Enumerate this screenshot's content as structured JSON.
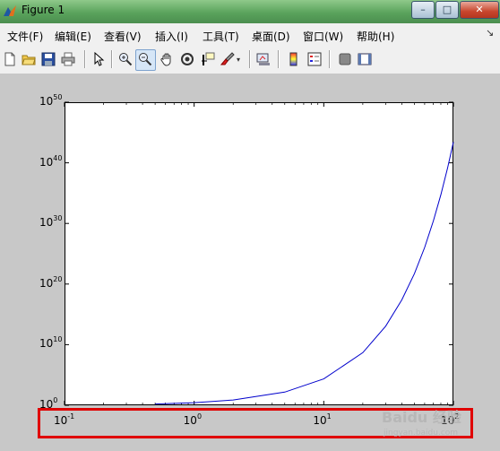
{
  "window": {
    "title": "Figure 1",
    "buttons": {
      "minimize": "–",
      "maximize": "□",
      "close": "✕"
    }
  },
  "menu": {
    "items": [
      "文件(F)",
      "编辑(E)",
      "查看(V)",
      "插入(I)",
      "工具(T)",
      "桌面(D)",
      "窗口(W)",
      "帮助(H)"
    ],
    "overflow": "↘"
  },
  "toolbar": {
    "icons": [
      "new-figure-icon",
      "open-file-icon",
      "save-icon",
      "print-icon",
      "pointer-icon",
      "zoom-in-icon",
      "zoom-out-icon",
      "pan-icon",
      "rotate-icon",
      "data-cursor-icon",
      "brush-icon",
      "link-plot-icon",
      "colorbar-icon",
      "legend-icon",
      "hide-plot-tools-icon",
      "show-plot-tools-icon"
    ],
    "active": "zoom-out-icon"
  },
  "chart_data": {
    "type": "line",
    "xscale": "log",
    "yscale": "log",
    "xlim": [
      0.1,
      100
    ],
    "ylim": [
      1,
      1e+50
    ],
    "x_ticks": [
      {
        "base": "10",
        "exp": "-1"
      },
      {
        "base": "10",
        "exp": "0"
      },
      {
        "base": "10",
        "exp": "1"
      },
      {
        "base": "10",
        "exp": "2"
      }
    ],
    "y_ticks": [
      {
        "base": "10",
        "exp": "50"
      },
      {
        "base": "10",
        "exp": "40"
      },
      {
        "base": "10",
        "exp": "30"
      },
      {
        "base": "10",
        "exp": "20"
      },
      {
        "base": "10",
        "exp": "10"
      },
      {
        "base": "10",
        "exp": "0"
      }
    ],
    "series": [
      {
        "color": "#0000cc",
        "x": [
          0.5,
          1,
          2,
          5,
          10,
          20,
          30,
          40,
          50,
          60,
          70,
          80,
          90,
          100
        ],
        "y": [
          1.6,
          2.7,
          7.4,
          148,
          22000.0,
          490000000.0,
          11000000000000.0,
          2.4e+17,
          5.2e+21,
          1.1e+26,
          2.5e+30,
          5.5e+34,
          1.2e+39,
          2.7e+43
        ]
      }
    ],
    "grid": false
  },
  "annotation": {
    "highlight_color": "#e00000",
    "target": "x-axis-tick-labels"
  },
  "watermark": {
    "line1": "Baidu 经验",
    "line2": "jingyan.baidu.com"
  }
}
